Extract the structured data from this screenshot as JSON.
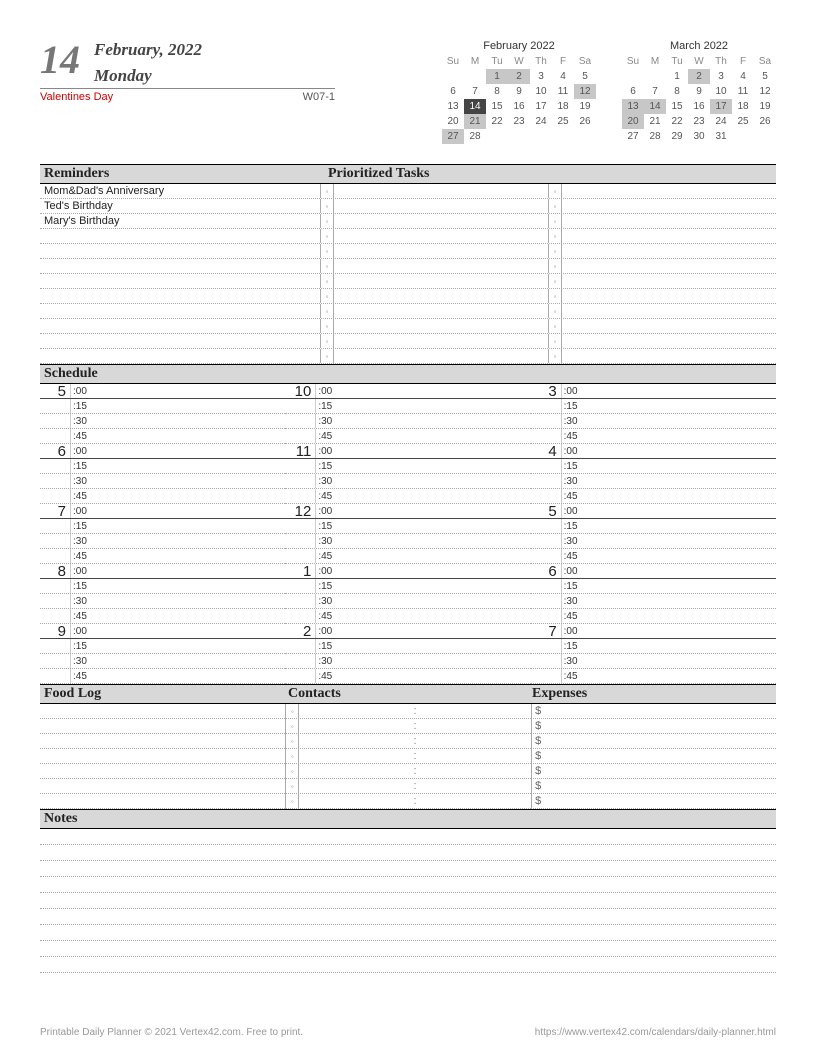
{
  "header": {
    "day_number": "14",
    "month_year": "February, 2022",
    "weekday": "Monday",
    "holiday": "Valentines Day",
    "week_code": "W07-1"
  },
  "mini_calendars": [
    {
      "title": "February 2022",
      "dow": [
        "Su",
        "M",
        "Tu",
        "W",
        "Th",
        "F",
        "Sa"
      ],
      "weeks": [
        [
          {
            "n": ""
          },
          {
            "n": ""
          },
          {
            "n": "1",
            "hl": true
          },
          {
            "n": "2",
            "hl": true
          },
          {
            "n": "3"
          },
          {
            "n": "4"
          },
          {
            "n": "5"
          }
        ],
        [
          {
            "n": "6"
          },
          {
            "n": "7"
          },
          {
            "n": "8"
          },
          {
            "n": "9"
          },
          {
            "n": "10"
          },
          {
            "n": "11"
          },
          {
            "n": "12",
            "hl": true
          }
        ],
        [
          {
            "n": "13"
          },
          {
            "n": "14",
            "today": true
          },
          {
            "n": "15"
          },
          {
            "n": "16"
          },
          {
            "n": "17"
          },
          {
            "n": "18"
          },
          {
            "n": "19"
          }
        ],
        [
          {
            "n": "20"
          },
          {
            "n": "21",
            "hl": true
          },
          {
            "n": "22"
          },
          {
            "n": "23"
          },
          {
            "n": "24"
          },
          {
            "n": "25"
          },
          {
            "n": "26"
          }
        ],
        [
          {
            "n": "27",
            "hl": true
          },
          {
            "n": "28"
          },
          {
            "n": ""
          },
          {
            "n": ""
          },
          {
            "n": ""
          },
          {
            "n": ""
          },
          {
            "n": ""
          }
        ]
      ]
    },
    {
      "title": "March 2022",
      "dow": [
        "Su",
        "M",
        "Tu",
        "W",
        "Th",
        "F",
        "Sa"
      ],
      "weeks": [
        [
          {
            "n": ""
          },
          {
            "n": ""
          },
          {
            "n": "1"
          },
          {
            "n": "2",
            "hl": true
          },
          {
            "n": "3"
          },
          {
            "n": "4"
          },
          {
            "n": "5"
          }
        ],
        [
          {
            "n": "6"
          },
          {
            "n": "7"
          },
          {
            "n": "8"
          },
          {
            "n": "9"
          },
          {
            "n": "10"
          },
          {
            "n": "11"
          },
          {
            "n": "12"
          }
        ],
        [
          {
            "n": "13",
            "hl": true
          },
          {
            "n": "14",
            "hl": true
          },
          {
            "n": "15"
          },
          {
            "n": "16"
          },
          {
            "n": "17",
            "hl": true
          },
          {
            "n": "18"
          },
          {
            "n": "19"
          }
        ],
        [
          {
            "n": "20",
            "hl": true
          },
          {
            "n": "21"
          },
          {
            "n": "22"
          },
          {
            "n": "23"
          },
          {
            "n": "24"
          },
          {
            "n": "25"
          },
          {
            "n": "26"
          }
        ],
        [
          {
            "n": "27"
          },
          {
            "n": "28"
          },
          {
            "n": "29"
          },
          {
            "n": "30"
          },
          {
            "n": "31"
          },
          {
            "n": ""
          },
          {
            "n": ""
          }
        ]
      ]
    }
  ],
  "sections": {
    "reminders": "Reminders",
    "tasks": "Prioritized Tasks",
    "schedule": "Schedule",
    "food": "Food Log",
    "contacts": "Contacts",
    "expenses": "Expenses",
    "notes": "Notes"
  },
  "reminders": [
    "Mom&Dad's Anniversary",
    "Ted's Birthday",
    "Mary's Birthday",
    "",
    "",
    "",
    "",
    "",
    "",
    "",
    "",
    ""
  ],
  "task_bullet": "◦",
  "task_rows": 12,
  "schedule": {
    "columns": [
      [
        "5",
        "6",
        "7",
        "8",
        "9"
      ],
      [
        "10",
        "11",
        "12",
        "1",
        "2"
      ],
      [
        "3",
        "4",
        "5",
        "6",
        "7"
      ]
    ],
    "minutes": [
      ":00",
      ":15",
      ":30",
      ":45"
    ]
  },
  "triple_rows": 7,
  "expense_symbol": "$",
  "contact_colon": ":",
  "notes_rows": 9,
  "footer": {
    "left": "Printable Daily Planner © 2021 Vertex42.com. Free to print.",
    "right": "https://www.vertex42.com/calendars/daily-planner.html"
  }
}
